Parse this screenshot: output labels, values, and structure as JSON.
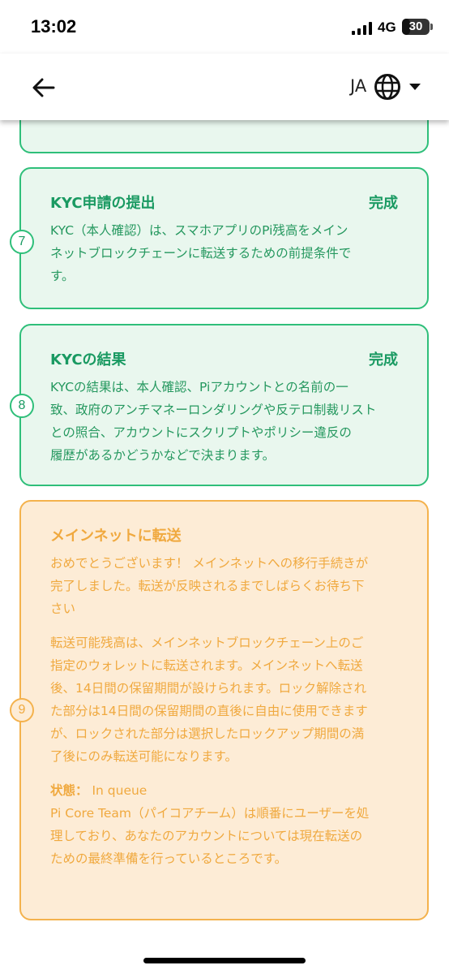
{
  "status_bar": {
    "time": "13:02",
    "network": "4G",
    "battery": "30",
    "battery_level": 0.3
  },
  "header": {
    "back_icon": "arrow-left-icon",
    "language": "JA",
    "globe_icon": "globe-icon",
    "dropdown_icon": "caret-down-icon"
  },
  "steps": [
    {
      "number": "7",
      "title": "KYC申請の提出",
      "status": "完成",
      "lines": [
        "KYC（本人確認）は、スマホアプリのPi残高をメイン",
        "ネットブロックチェーンに転送するための前提条件で",
        "す。"
      ]
    },
    {
      "number": "8",
      "title": "KYCの結果",
      "status": "完成",
      "lines": [
        "KYCの結果は、本人確認、Piアカウントとの名前の一",
        "致、政府のアンチマネーロンダリングや反テロ制裁リスト",
        "との照合、アカウントにスクリプトやポリシー違反の",
        "履歴があるかどうかなどで決まります。"
      ]
    },
    {
      "number": "9",
      "title": "メインネットに転送",
      "intro_lines": [
        "おめでとうございます！ メインネットへの移行手続きが",
        "完了しました。転送が反映されるまでしばらくお待ち下",
        "さい"
      ],
      "detail_lines": [
        "転送可能残高は、メインネットブロックチェーン上のご",
        "指定のウォレットに転送されます。メインネットへ転送",
        "後、14日間の保留期間が設けられます。ロック解除され",
        "た部分は14日間の保留期間の直後に自由に使用できます",
        "が、ロックされた部分は選択したロックアップ期間の満",
        "了後にのみ転送可能になります。"
      ],
      "status_label": "状態：",
      "status_value": "In queue",
      "queue_lines": [
        "Pi Core Team（パイコアチーム）は順番にユーザーを処",
        "理しており、あなたのアカウントについては現在転送の",
        "ための最終準備を行っているところです。"
      ]
    }
  ],
  "colors": {
    "complete_border": "#2fbf7a",
    "complete_bg": "#e9f7ee",
    "complete_text": "#1a9a62",
    "pending_border": "#f4b24d",
    "pending_bg": "#fdecd6",
    "pending_text": "#f0a93f"
  }
}
